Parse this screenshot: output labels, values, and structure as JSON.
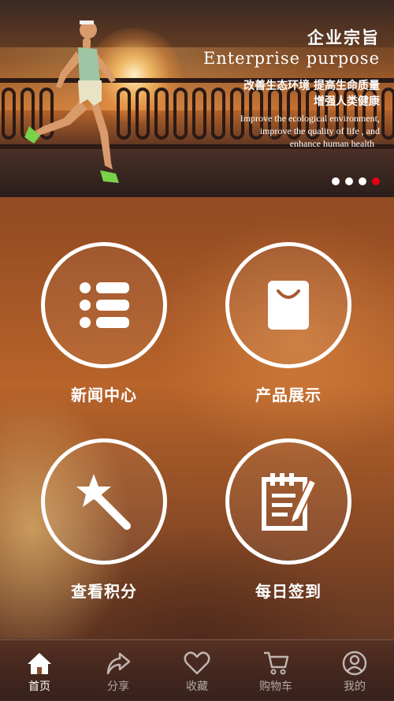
{
  "banner": {
    "title": "企业宗旨",
    "subtitle": "Enterprise  purpose",
    "cn_line1": "改善生态环境  提高生命质量",
    "cn_line2": "增强人类健康",
    "en_line1": "Improve the ecological environment,",
    "en_line2": "improve the quality of life , and",
    "en_line3": "enhance human health",
    "slide_count": 4,
    "active_slide": 4
  },
  "tiles": [
    {
      "label": "新闻中心",
      "icon": "list-icon"
    },
    {
      "label": "产品展示",
      "icon": "shopping-bag-icon"
    },
    {
      "label": "查看积分",
      "icon": "magic-wand-icon"
    },
    {
      "label": "每日签到",
      "icon": "notepad-pen-icon"
    }
  ],
  "nav": [
    {
      "label": "首页",
      "icon": "home-icon",
      "active": true
    },
    {
      "label": "分享",
      "icon": "share-icon",
      "active": false
    },
    {
      "label": "收藏",
      "icon": "heart-icon",
      "active": false
    },
    {
      "label": "购物车",
      "icon": "cart-icon",
      "active": false
    },
    {
      "label": "我的",
      "icon": "user-icon",
      "active": false
    }
  ],
  "colors": {
    "active_dot": "#e60012",
    "text": "#ffffff"
  }
}
